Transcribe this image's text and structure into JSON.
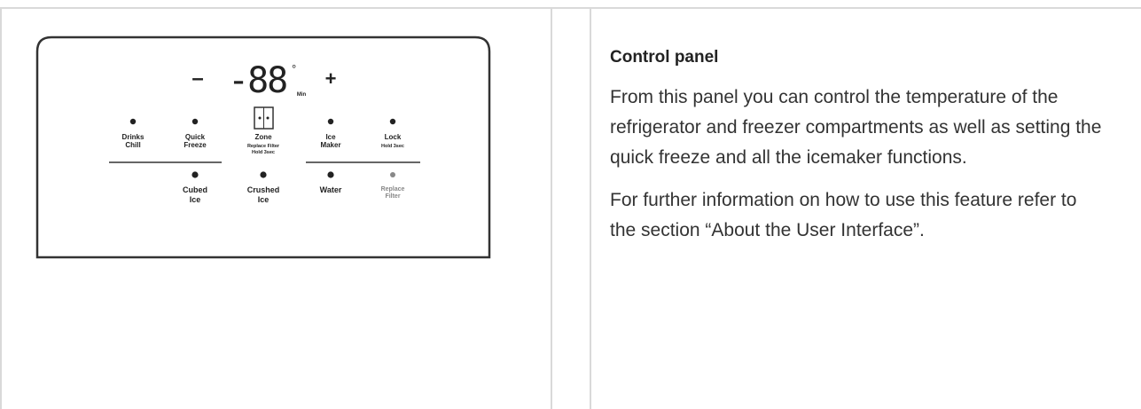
{
  "article": {
    "heading": "Control panel",
    "paragraph1": "From this panel you can control the temperature of the refrigerator and freezer compartments as well as setting the quick freeze and all the icemaker functions.",
    "paragraph2": "For further information on how to use this feature refer to the section “About the User Interface”."
  },
  "panel": {
    "minus": "–",
    "display": "-88",
    "degree": "°",
    "display_unit": "Min",
    "plus": "+",
    "top_buttons": [
      {
        "line1": "Drinks",
        "line2": "Chill"
      },
      {
        "line1": "Quick",
        "line2": "Freeze"
      },
      {
        "line1": "Zone",
        "line2": "Replace Filter",
        "line3": "Hold 3sec"
      },
      {
        "line1": "Ice",
        "line2": "Maker"
      },
      {
        "line1": "Lock",
        "line2": "Hold 3sec"
      }
    ],
    "bottom_buttons": [
      {
        "line1": "Cubed",
        "line2": "Ice"
      },
      {
        "line1": "Crushed",
        "line2": "Ice"
      },
      {
        "line1": "Water"
      },
      {
        "line1": "Replace",
        "line2": "Filter"
      }
    ]
  }
}
